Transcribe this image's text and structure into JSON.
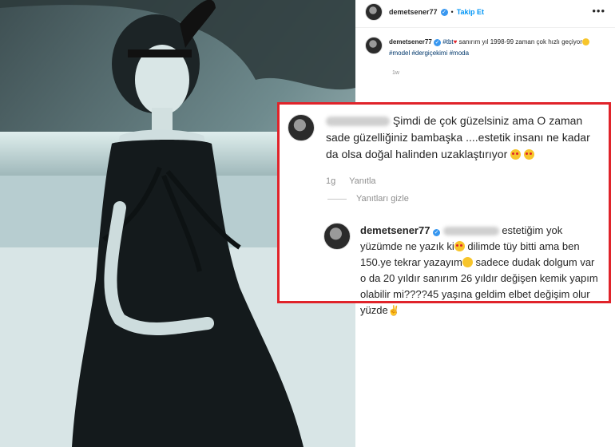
{
  "post": {
    "username": "demetsener77",
    "dot": "•",
    "follow_label": "Takip Et",
    "more_label": "•••",
    "caption_prefix": "sanırım yıl 1998-99 zaman çok hızlı geçiyor",
    "caption_tag_tbt": "#tbt",
    "caption_tags": "#model #dergiçekimi #moda",
    "time": "1w"
  },
  "comment": {
    "text": "Şimdi de çok güzelsiniz ama O zaman sade güzelliğiniz bambaşka ....estetik insanı ne kadar da olsa doğal halinden uzaklaştırıyor",
    "time": "1g",
    "reply_label": "Yanıtla",
    "hide_replies_label": "Yanıtları gizle"
  },
  "reply": {
    "username": "demetsener77",
    "text_1": "estetiğim yok yüzümde ne yazık ki",
    "text_2": "dilimde tüy bitti ama ben 150.ye tekrar yazayım",
    "text_3": "sadece dudak dolgum var o da 20 yıldır sanırım 26 yıldır değişen kemik yapım olabilir mi????45 yaşına geldim elbet değişim olur yüzde"
  },
  "colors": {
    "highlight_border": "#e0232a",
    "link_blue": "#0095f6",
    "verified_blue": "#3897f0"
  }
}
